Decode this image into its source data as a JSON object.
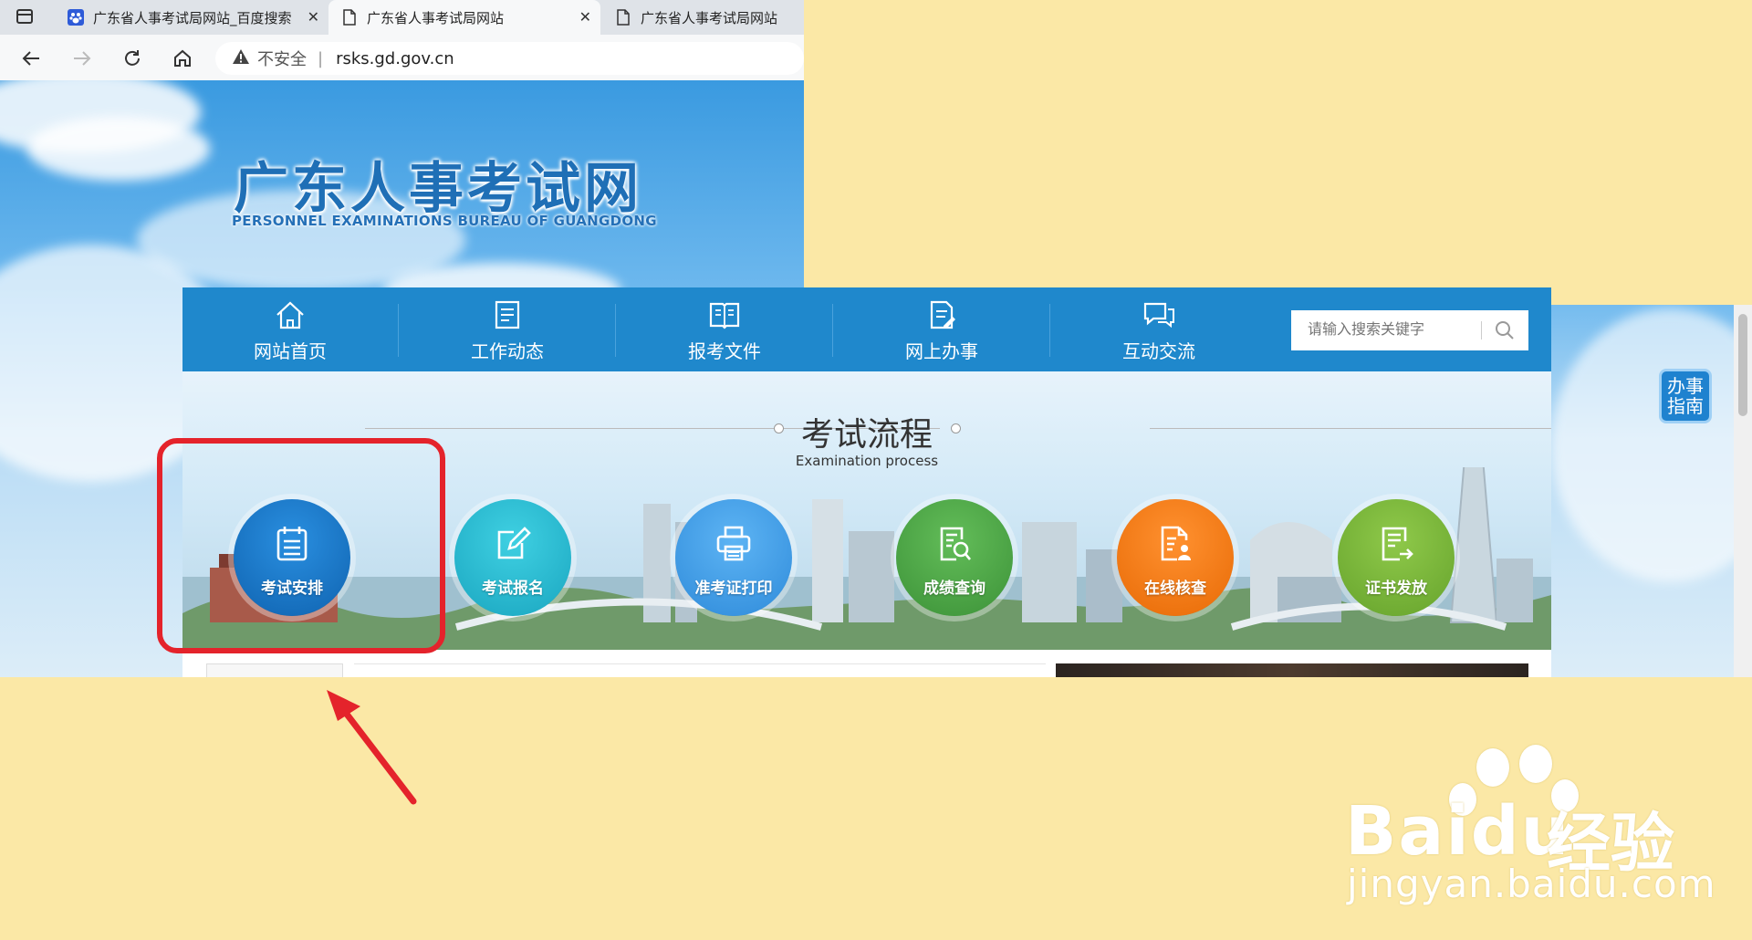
{
  "browser": {
    "tabs": [
      {
        "title": "广东省人事考试局网站_百度搜索",
        "icon": "baidu-paw-icon",
        "active": false
      },
      {
        "title": "广东省人事考试局网站",
        "icon": "page-icon",
        "active": true
      },
      {
        "title": "广东省人事考试局网站",
        "icon": "page-icon",
        "active": false
      }
    ],
    "security_label": "不安全",
    "url": "rsks.gd.gov.cn"
  },
  "site": {
    "title": "广东人事考试网",
    "subtitle": "PERSONNEL EXAMINATIONS BUREAU OF GUANGDONG"
  },
  "nav": {
    "items": [
      {
        "label": "网站首页",
        "icon": "home-icon"
      },
      {
        "label": "工作动态",
        "icon": "news-icon"
      },
      {
        "label": "报考文件",
        "icon": "book-icon"
      },
      {
        "label": "网上办事",
        "icon": "edit-doc-icon"
      },
      {
        "label": "互动交流",
        "icon": "chat-icon"
      }
    ],
    "search_placeholder": "请输入搜索关键字"
  },
  "process": {
    "title": "考试流程",
    "subtitle": "Examination process",
    "steps": [
      {
        "label": "考试安排",
        "icon": "schedule-icon",
        "color": "#1677c5"
      },
      {
        "label": "考试报名",
        "icon": "edit-icon",
        "color": "#27b8cf"
      },
      {
        "label": "准考证打印",
        "icon": "printer-icon",
        "color": "#3a9de8"
      },
      {
        "label": "成绩查询",
        "icon": "search-doc-icon",
        "color": "#4ea846"
      },
      {
        "label": "在线核查",
        "icon": "verify-user-icon",
        "color": "#f07a12"
      },
      {
        "label": "证书发放",
        "icon": "certificate-icon",
        "color": "#7cb53a"
      }
    ]
  },
  "guide": {
    "label": "办事指南"
  },
  "watermark": {
    "brand": "Baidu",
    "brand_cn": "经验",
    "url": "jingyan.baidu.com"
  },
  "colors": {
    "nav_bar": "#1f88cc",
    "highlight": "#e4232b",
    "background": "#fbe8a6"
  }
}
